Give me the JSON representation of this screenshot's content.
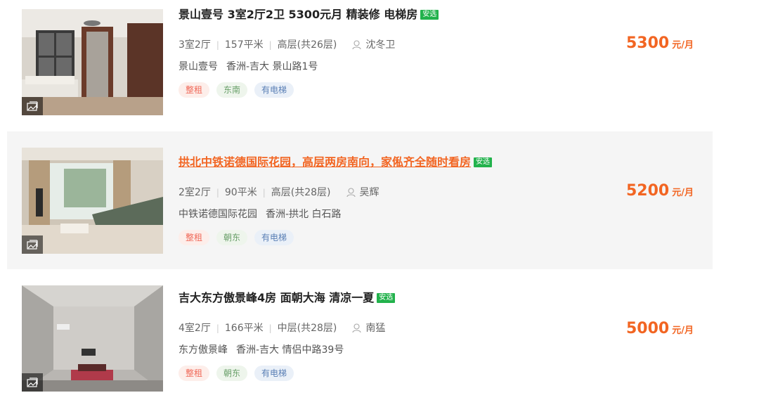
{
  "listings": [
    {
      "title": "景山壹号 3室2厅2卫 5300元月 精装修 电梯房",
      "badge": "安选",
      "rooms": "3室2厅",
      "area": "157平米",
      "floor": "高层(共26层)",
      "agent": "沈冬卫",
      "community": "景山壹号",
      "location": "香洲-吉大 景山路1号",
      "tags": [
        "整租",
        "东南",
        "有电梯"
      ],
      "price": "5300",
      "price_unit": "元/月"
    },
    {
      "title": "拱北中铁诺德国际花园，高层两房南向，家俬齐全随时看房",
      "badge": "安选",
      "rooms": "2室2厅",
      "area": "90平米",
      "floor": "高层(共28层)",
      "agent": "吴辉",
      "community": "中铁诺德国际花园",
      "location": "香洲-拱北 白石路",
      "tags": [
        "整租",
        "朝东",
        "有电梯"
      ],
      "price": "5200",
      "price_unit": "元/月"
    },
    {
      "title": "吉大东方傲景峰4房 面朝大海 清凉一夏",
      "badge": "安选",
      "rooms": "4室2厅",
      "area": "166平米",
      "floor": "中层(共28层)",
      "agent": "南猛",
      "community": "东方傲景峰",
      "location": "香洲-吉大 情侣中路39号",
      "tags": [
        "整租",
        "朝东",
        "有电梯"
      ],
      "price": "5000",
      "price_unit": "元/月"
    }
  ],
  "colors": {
    "price": "#f26522",
    "badge": "#22b24c",
    "hover_bg": "#f5f5f5"
  }
}
